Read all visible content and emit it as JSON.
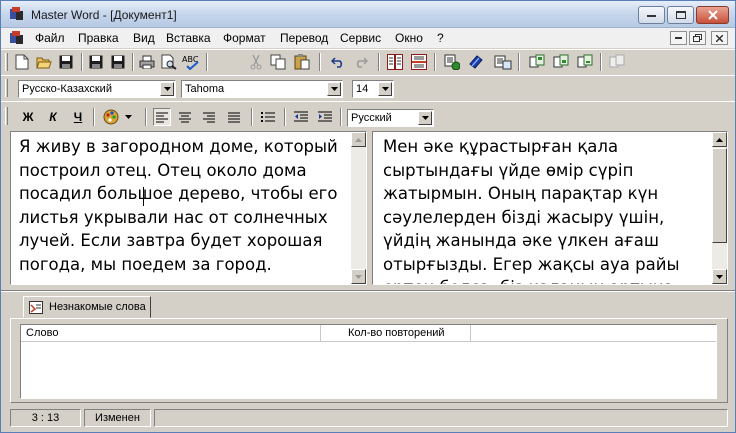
{
  "window": {
    "title": "Master Word - [Документ1]"
  },
  "menu": {
    "items": [
      {
        "label": "Файл"
      },
      {
        "label": "Правка"
      },
      {
        "label": "Вид"
      },
      {
        "label": "Вставка"
      },
      {
        "label": "Формат"
      },
      {
        "label": "Перевод"
      },
      {
        "label": "Сервис"
      },
      {
        "label": "Окно"
      },
      {
        "label": "?"
      }
    ]
  },
  "toolbar_standard": {
    "icons": [
      "new-icon",
      "open-icon",
      "save-icon",
      "save-all-icon",
      "save-as-icon",
      "print-icon",
      "print-preview-icon",
      "spellcheck-icon",
      "cut-icon",
      "copy-icon",
      "paste-icon",
      "undo-icon",
      "redo-icon",
      "layout-vertical-icon",
      "layout-horizontal-icon",
      "translate-icon",
      "dictionary-icon",
      "dictionary-view-icon",
      "export-icon",
      "import-icon",
      "sync-icon",
      "disabled-icon"
    ]
  },
  "format_bar": {
    "language_pair": "Русско-Казахский",
    "font": "Tahoma",
    "size": "14",
    "bold_label": "Ж",
    "italic_label": "К",
    "underline_label": "Ч",
    "lang_select": "Русский"
  },
  "source_text": "Я живу в загородном доме, который построил отец. Отец около дома посадил большое дерево, чтобы его листья укрывали нас от солнечных лучей. Если завтра будет хорошая погода, мы поедем за город.",
  "target_text": "Мен әке құрастырған қала сыртындағы үйде өмір сүріп жатырмын. Оның парақтар күн сәулелерден бізді жасыру үшін, үйдің жанында әке үлкен ағаш отырғызды. Егер жақсы ауа райы ертең болса, біз қаланың артына",
  "bottom_panel": {
    "tab_label": "Незнакомые слова",
    "columns": [
      "Слово",
      "Кол-во повторений"
    ]
  },
  "status": {
    "position": "3 : 13",
    "state": "Изменен"
  },
  "colors": {
    "face": "#d4d0c8",
    "title_gradient_top": "#e6eef8",
    "title_gradient_bottom": "#b7c9e4"
  }
}
